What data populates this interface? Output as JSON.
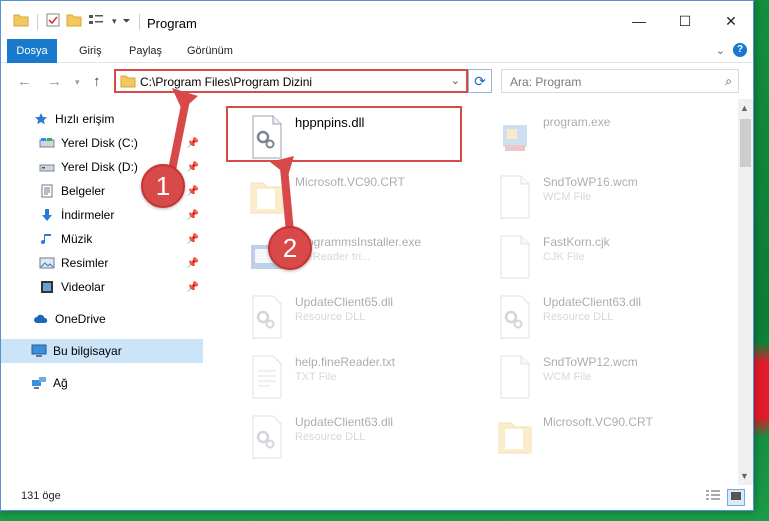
{
  "window": {
    "title": "Program",
    "controls": {
      "minimize": "—",
      "maximize": "☐",
      "close": "✕"
    }
  },
  "ribbon": {
    "tabs": [
      {
        "label": "Dosya",
        "active": true
      },
      {
        "label": "Giriş",
        "active": false
      },
      {
        "label": "Paylaş",
        "active": false
      },
      {
        "label": "Görünüm",
        "active": false
      }
    ]
  },
  "address": {
    "path": "C:\\Program Files\\Program Dizini",
    "search_placeholder": "Ara: Program"
  },
  "sidebar": {
    "items": [
      {
        "label": "Hızlı erişim",
        "icon": "star-icon",
        "pinned": false
      },
      {
        "label": "Yerel Disk (C:)",
        "icon": "drive-icon",
        "pinned": true
      },
      {
        "label": "Yerel Disk (D:)",
        "icon": "drive-icon",
        "pinned": true
      },
      {
        "label": "Belgeler",
        "icon": "documents-icon",
        "pinned": true
      },
      {
        "label": "İndirmeler",
        "icon": "download-icon",
        "pinned": true
      },
      {
        "label": "Müzik",
        "icon": "music-icon",
        "pinned": true
      },
      {
        "label": "Resimler",
        "icon": "pictures-icon",
        "pinned": true
      },
      {
        "label": "Videolar",
        "icon": "video-icon",
        "pinned": true
      },
      {
        "label": "OneDrive",
        "icon": "cloud-icon",
        "pinned": false
      },
      {
        "label": "Bu bilgisayar",
        "icon": "computer-icon",
        "pinned": false,
        "selected": true
      },
      {
        "label": "Ağ",
        "icon": "network-icon",
        "pinned": false
      }
    ]
  },
  "files": [
    {
      "name": "hppnpins.dll",
      "type": "",
      "icon": "dll-gear-icon",
      "highlighted": true
    },
    {
      "name": "program.exe",
      "type": "",
      "icon": "exe-icon"
    },
    {
      "name": "Microsoft.VC90.CRT",
      "type": "",
      "icon": "folder-icon"
    },
    {
      "name": "SndToWP16.wcm",
      "type": "WCM File",
      "icon": "blank-file-icon"
    },
    {
      "name": "ProgrammsInstaller.exe",
      "type": "fineReader tri...",
      "icon": "installer-icon"
    },
    {
      "name": "FastKorn.cjk",
      "type": "CJK File",
      "icon": "blank-file-icon"
    },
    {
      "name": "UpdateClient65.dll",
      "type": "Resource DLL",
      "icon": "dll-gear-icon"
    },
    {
      "name": "UpdateClient63.dll",
      "type": "Resource DLL",
      "icon": "dll-gear-icon"
    },
    {
      "name": "help.fineReader.txt",
      "type": "TXT File",
      "icon": "text-file-icon"
    },
    {
      "name": "SndToWP12.wcm",
      "type": "WCM File",
      "icon": "blank-file-icon"
    },
    {
      "name": "UpdateClient63.dll",
      "type": "Resource DLL",
      "icon": "dll-gear-icon"
    },
    {
      "name": "Microsoft.VC90.CRT",
      "type": "",
      "icon": "folder-icon"
    }
  ],
  "status": {
    "count": "131 öge"
  },
  "annotations": {
    "step1": "1",
    "step2": "2"
  },
  "colors": {
    "accent": "#1979ca",
    "annotation_red": "#d84a4a",
    "selection": "#cce4f7"
  }
}
